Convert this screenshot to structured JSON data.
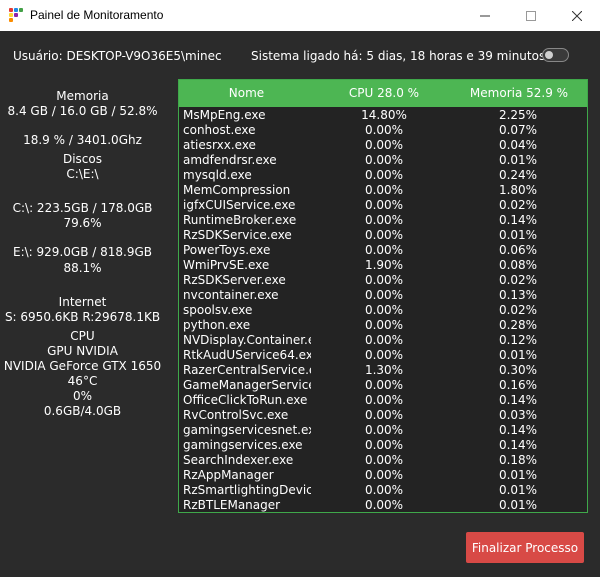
{
  "window": {
    "title": "Painel de Monitoramento"
  },
  "header": {
    "user": "Usuário: DESKTOP-V9O36E5\\minec",
    "uptime": "Sistema ligado há: 5 dias, 18 horas e 39 minutos"
  },
  "sidebar": {
    "memory_title": "Memoria",
    "memory_value": "8.4 GB / 16.0 GB / 52.8%",
    "cpu_value": "18.9 % / 3401.0Ghz",
    "disks_title": "Discos",
    "disks_list": "C:\\E:\\",
    "disk_c_usage": "C:\\: 223.5GB / 178.0GB",
    "disk_c_percent": "79.6%",
    "disk_e_usage": "E:\\: 929.0GB / 818.9GB",
    "disk_e_percent": "88.1%",
    "internet_title": "Internet",
    "internet_value": "S: 6950.6KB R:29678.1KB",
    "cpu_title": "CPU",
    "gpu_title": "GPU NVIDIA",
    "gpu_name": "NVIDIA GeForce GTX 1650",
    "gpu_temp": "46°C",
    "gpu_usage": "0%",
    "gpu_memory": "0.6GB/4.0GB"
  },
  "table": {
    "headers": {
      "name": "Nome",
      "cpu": "CPU 28.0 %",
      "memory": "Memoria 52.9 %"
    },
    "rows": [
      {
        "name": "MsMpEng.exe",
        "cpu": "14.80%",
        "mem": "2.25%"
      },
      {
        "name": "conhost.exe",
        "cpu": "0.00%",
        "mem": "0.07%"
      },
      {
        "name": "atiesrxx.exe",
        "cpu": "0.00%",
        "mem": "0.04%"
      },
      {
        "name": "amdfendrsr.exe",
        "cpu": "0.00%",
        "mem": "0.01%"
      },
      {
        "name": "mysqld.exe",
        "cpu": "0.00%",
        "mem": "0.24%"
      },
      {
        "name": "MemCompression",
        "cpu": "0.00%",
        "mem": "1.80%"
      },
      {
        "name": "igfxCUIService.exe",
        "cpu": "0.00%",
        "mem": "0.02%"
      },
      {
        "name": "RuntimeBroker.exe",
        "cpu": "0.00%",
        "mem": "0.14%"
      },
      {
        "name": "RzSDKService.exe",
        "cpu": "0.00%",
        "mem": "0.01%"
      },
      {
        "name": "PowerToys.exe",
        "cpu": "0.00%",
        "mem": "0.06%"
      },
      {
        "name": "WmiPrvSE.exe",
        "cpu": "1.90%",
        "mem": "0.08%"
      },
      {
        "name": "RzSDKServer.exe",
        "cpu": "0.00%",
        "mem": "0.02%"
      },
      {
        "name": "nvcontainer.exe",
        "cpu": "0.00%",
        "mem": "0.13%"
      },
      {
        "name": "spoolsv.exe",
        "cpu": "0.00%",
        "mem": "0.02%"
      },
      {
        "name": "python.exe",
        "cpu": "0.00%",
        "mem": "0.28%"
      },
      {
        "name": "NVDisplay.Container.exe",
        "cpu": "0.00%",
        "mem": "0.12%"
      },
      {
        "name": "RtkAudUService64.exe",
        "cpu": "0.00%",
        "mem": "0.01%"
      },
      {
        "name": "RazerCentralService.exe",
        "cpu": "1.30%",
        "mem": "0.30%"
      },
      {
        "name": "GameManagerService.exe",
        "cpu": "0.00%",
        "mem": "0.16%"
      },
      {
        "name": "OfficeClickToRun.exe",
        "cpu": "0.00%",
        "mem": "0.14%"
      },
      {
        "name": "RvControlSvc.exe",
        "cpu": "0.00%",
        "mem": "0.03%"
      },
      {
        "name": "gamingservicesnet.exe",
        "cpu": "0.00%",
        "mem": "0.14%"
      },
      {
        "name": "gamingservices.exe",
        "cpu": "0.00%",
        "mem": "0.14%"
      },
      {
        "name": "SearchIndexer.exe",
        "cpu": "0.00%",
        "mem": "0.18%"
      },
      {
        "name": "RzAppManager",
        "cpu": "0.00%",
        "mem": "0.01%"
      },
      {
        "name": "RzSmartlightingDeviceManager",
        "cpu": "0.00%",
        "mem": "0.01%"
      },
      {
        "name": "RzBTLEManager",
        "cpu": "0.00%",
        "mem": "0.01%"
      }
    ]
  },
  "actions": {
    "kill_process": "Finalizar Processo"
  },
  "colors": {
    "accent_green": "#4db653",
    "danger_red": "#d84a46",
    "background": "#2b2b2b"
  }
}
